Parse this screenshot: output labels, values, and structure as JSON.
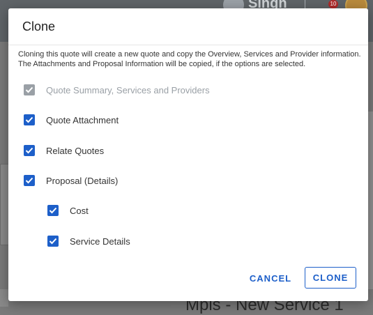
{
  "background": {
    "user_initial_text": "Singh",
    "notification_count": "10",
    "bottom_text": "Mpls - New Service 1"
  },
  "dialog": {
    "title": "Clone",
    "description": "Cloning this quote will create a new quote and copy the Overview, Services and Provider information. The Attachments and Proposal Information will be copied, if the options are selected.",
    "options": [
      {
        "label": "Quote Summary, Services and Providers",
        "checked": true,
        "disabled": true
      },
      {
        "label": "Quote Attachment",
        "checked": true,
        "disabled": false
      },
      {
        "label": "Relate Quotes",
        "checked": true,
        "disabled": false
      },
      {
        "label": "Proposal (Details)",
        "checked": true,
        "disabled": false
      },
      {
        "label": "Cost",
        "checked": true,
        "disabled": false
      },
      {
        "label": "Service Details",
        "checked": true,
        "disabled": false
      }
    ],
    "cancel_label": "CANCEL",
    "clone_label": "CLONE"
  },
  "colors": {
    "accent": "#1d5fc9",
    "disabled": "#9aa0a6"
  }
}
